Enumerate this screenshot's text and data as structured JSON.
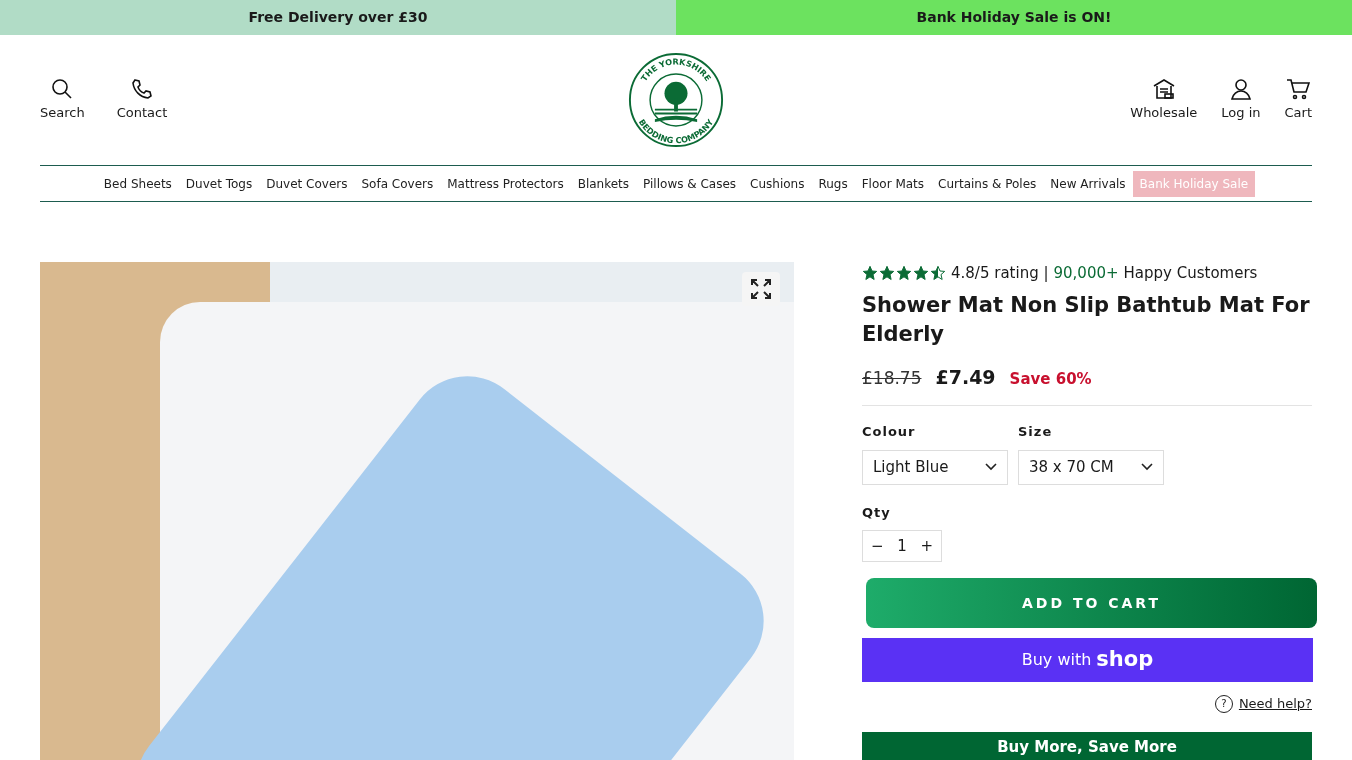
{
  "announcements": [
    {
      "text": "Free Delivery over £30",
      "color": "#b1dcc6"
    },
    {
      "text": "Bank Holiday Sale is ON!",
      "color": "#6ce25f"
    }
  ],
  "header": {
    "left_actions": [
      {
        "label": "Search"
      },
      {
        "label": "Contact"
      }
    ],
    "logo": {
      "top_text": "THE YORKSHIRE",
      "bottom_text": "BEDDING COMPANY"
    },
    "right_actions": [
      {
        "label": "Wholesale"
      },
      {
        "label": "Log in"
      },
      {
        "label": "Cart"
      }
    ]
  },
  "nav": [
    {
      "label": "Bed Sheets",
      "highlighted": false
    },
    {
      "label": "Duvet Togs",
      "highlighted": false
    },
    {
      "label": "Duvet Covers",
      "highlighted": false
    },
    {
      "label": "Sofa Covers",
      "highlighted": false
    },
    {
      "label": "Mattress Protectors",
      "highlighted": false
    },
    {
      "label": "Blankets",
      "highlighted": false
    },
    {
      "label": "Pillows & Cases",
      "highlighted": false
    },
    {
      "label": "Cushions",
      "highlighted": false
    },
    {
      "label": "Rugs",
      "highlighted": false
    },
    {
      "label": "Floor Mats",
      "highlighted": false
    },
    {
      "label": "Curtains & Poles",
      "highlighted": false
    },
    {
      "label": "New Arrivals",
      "highlighted": false
    },
    {
      "label": "Bank Holiday Sale",
      "highlighted": true
    }
  ],
  "product": {
    "stars": 4.5,
    "rating_text": "4.8/5 rating |",
    "customers_count": "90,000+",
    "customers_label": "Happy Customers",
    "title": "Shower Mat Non Slip Bathtub Mat For Elderly",
    "old_price": "£18.75",
    "price": "£7.49",
    "saving": "Save 60%",
    "options": [
      {
        "label": "Colour",
        "value": "Light Blue"
      },
      {
        "label": "Size",
        "value": "38 x 70 CM"
      }
    ],
    "qty_label": "Qty",
    "minus": "−",
    "qty": "1",
    "plus": "+",
    "add_to_cart": "ADD TO CART",
    "shop_pay_prefix": "Buy with",
    "shop_pay_brand": "shop",
    "help_icon": "?",
    "help_link": "Need help?",
    "bundle_banner": "Buy More, Save More"
  }
}
